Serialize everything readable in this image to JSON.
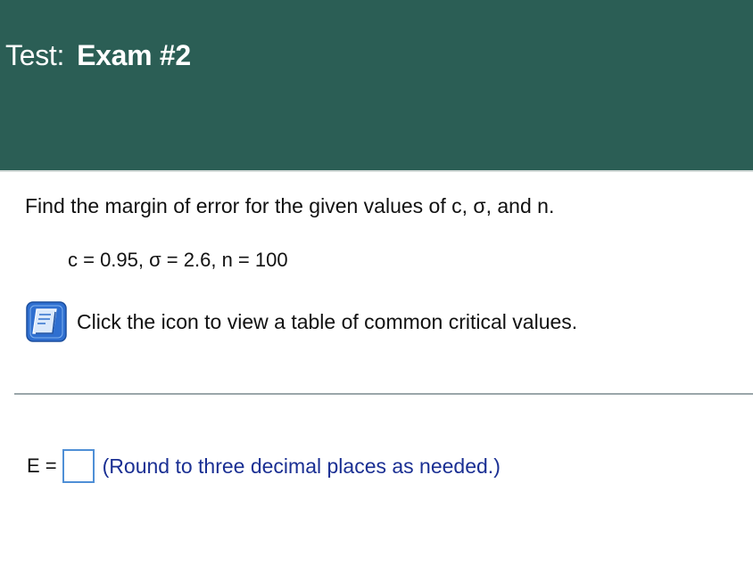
{
  "header": {
    "label": "Test:",
    "name": "Exam #2"
  },
  "question": {
    "prompt": "Find the margin of error for the given values of c, σ, and n.",
    "given": "c = 0.95, σ = 2.6, n = 100",
    "table_link_text": "Click the icon to view a table of common critical values.",
    "table_icon": "book-icon"
  },
  "answer": {
    "label": "E =",
    "value": "",
    "hint": "(Round to three decimal places as needed.)"
  },
  "colors": {
    "header_bg": "#2b5e55",
    "hint_text": "#1a2f93",
    "input_border": "#4f8fd6",
    "icon_blue": "#2f6fd0"
  }
}
